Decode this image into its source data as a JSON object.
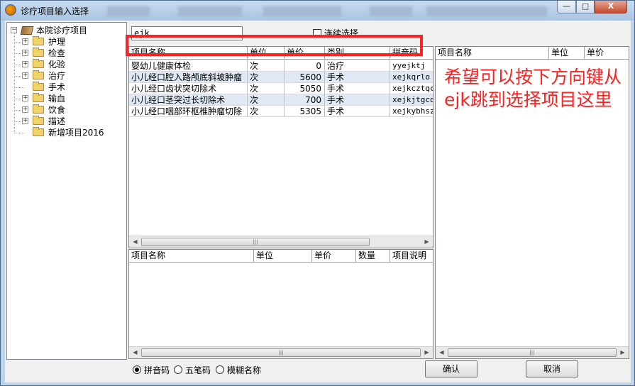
{
  "window": {
    "title": "诊疗项目输入选择"
  },
  "titlebar_buttons": {
    "minimize": "—",
    "maximize": "□",
    "close": "X"
  },
  "tree": {
    "root": "本院诊疗项目",
    "items": [
      {
        "label": "护理",
        "expandable": true
      },
      {
        "label": "检查",
        "expandable": true
      },
      {
        "label": "化验",
        "expandable": true
      },
      {
        "label": "治疗",
        "expandable": true
      },
      {
        "label": "手术",
        "expandable": false
      },
      {
        "label": "输血",
        "expandable": true
      },
      {
        "label": "饮食",
        "expandable": true
      },
      {
        "label": "描述",
        "expandable": true
      },
      {
        "label": "新增项目2016",
        "expandable": false
      }
    ]
  },
  "search": {
    "value": "ejk",
    "continuous_select_label": "连续选择",
    "continuous_select_checked": false
  },
  "results_grid": {
    "columns": [
      "项目名称",
      "单位",
      "单价",
      "类别",
      "拼音码"
    ],
    "rows": [
      {
        "name": "婴幼儿健康体检",
        "unit": "次",
        "price": "0",
        "category": "治疗",
        "pinyin": "yyejktj"
      },
      {
        "name": "小儿经口腔入路颅底斜坡肿瘤",
        "unit": "次",
        "price": "5600",
        "category": "手术",
        "pinyin": "xejkqrlo"
      },
      {
        "name": "小儿经口齿状突切除术",
        "unit": "次",
        "price": "5050",
        "category": "手术",
        "pinyin": "xejkcztqc"
      },
      {
        "name": "小儿经口茎突过长切除术",
        "unit": "次",
        "price": "700",
        "category": "手术",
        "pinyin": "xejkjtgcq"
      },
      {
        "name": "小儿经口咽部环枢椎肿瘤切除",
        "unit": "次",
        "price": "5305",
        "category": "手术",
        "pinyin": "xejkybhsz"
      }
    ]
  },
  "selected_grid": {
    "columns": [
      "项目名称",
      "单位",
      "单价",
      "数量",
      "项目说明"
    ]
  },
  "right_grid": {
    "columns": [
      "项目名称",
      "单位",
      "单价"
    ]
  },
  "annotation": {
    "text": "希望可以按下方向键从ejk跳到选择项目这里"
  },
  "input_method": {
    "options": [
      "拼音码",
      "五笔码",
      "模糊名称"
    ],
    "selected": "拼音码"
  },
  "buttons": {
    "confirm": "确认",
    "cancel": "取消"
  },
  "colors": {
    "highlight": "#ff2222",
    "annotation": "#ff2020",
    "alt_row": "#dfeaf6"
  }
}
